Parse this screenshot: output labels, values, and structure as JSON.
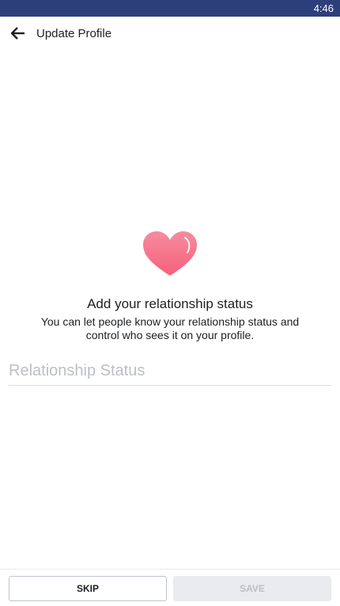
{
  "status_bar": {
    "time": "4:46",
    "color": "#2d3f7a"
  },
  "header": {
    "title": "Update Profile",
    "back_icon": "arrow-left-icon"
  },
  "hero": {
    "icon": "heart-icon",
    "heart_colors": [
      "#f8607a",
      "#f48ca0"
    ],
    "headline": "Add your relationship status",
    "description": "You can let people know your relationship status and control who sees it on your profile."
  },
  "form": {
    "relationship_placeholder": "Relationship Status",
    "relationship_value": ""
  },
  "footer": {
    "skip_label": "SKIP",
    "save_label": "SAVE",
    "save_enabled": false
  }
}
